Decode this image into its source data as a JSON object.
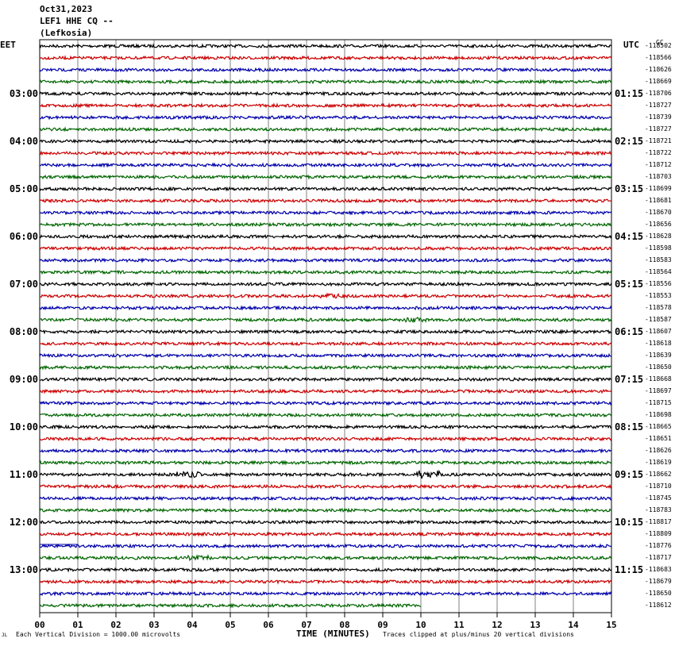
{
  "header": {
    "date": "Oct31,2023",
    "station": "LEF1 HHE CQ --",
    "location": "(Lefkosia)"
  },
  "left_tz": "EET",
  "right_tz": "UTC",
  "corner_mark": "GC",
  "footer": {
    "scale_note": "Each Vertical Division = 1000.00 microvolts",
    "xlabel": "TIME (MINUTES)",
    "clip_note": "Traces clipped at plus/minus 20 vertical divisions",
    "logo_mark": "JL"
  },
  "colors": {
    "trace_cycle": [
      "#000000",
      "#cc0000",
      "#0000aa",
      "#006600"
    ],
    "grid": "#808080"
  },
  "chart_data": {
    "type": "line",
    "title": "",
    "xlabel": "TIME (MINUTES)",
    "ylabel": "",
    "xlim": [
      0,
      15
    ],
    "x_ticks": [
      "00",
      "01",
      "02",
      "03",
      "04",
      "05",
      "06",
      "07",
      "08",
      "09",
      "10",
      "11",
      "12",
      "13",
      "14",
      "15"
    ],
    "left_hour_labels": [
      "03:00",
      "04:00",
      "05:00",
      "06:00",
      "07:00",
      "08:00",
      "09:00",
      "10:00",
      "11:00",
      "12:00",
      "13:00"
    ],
    "right_hour_labels": [
      "01:15",
      "02:15",
      "03:15",
      "04:15",
      "05:15",
      "06:15",
      "07:15",
      "08:15",
      "09:15",
      "10:15",
      "11:15"
    ],
    "trace_offsets": [
      -118502,
      -118566,
      -118626,
      -118669,
      -118706,
      -118727,
      -118739,
      -118727,
      -118721,
      -118722,
      -118712,
      -118703,
      -118699,
      -118681,
      -118670,
      -118656,
      -118628,
      -118598,
      -118583,
      -118564,
      -118556,
      -118553,
      -118578,
      -118587,
      -118607,
      -118618,
      -118639,
      -118650,
      -118668,
      -118697,
      -118715,
      -118698,
      -118665,
      -118651,
      -118626,
      -118619,
      -118662,
      -118710,
      -118745,
      -118783,
      -118817,
      -118809,
      -118776,
      -118717,
      -118683,
      -118679,
      -118650,
      -118612
    ],
    "first_trace_start_minute": 0,
    "last_trace_end_minute": 10,
    "trace_amplitude_divisions": 0.12,
    "noisy_events": [
      {
        "trace": 36,
        "minute": 3.9,
        "amplitude": 0.25
      },
      {
        "trace": 36,
        "minute": 10.2,
        "amplitude": 0.35
      },
      {
        "trace": 21,
        "minute": 7.6,
        "amplitude": 0.2
      },
      {
        "trace": 23,
        "minute": 9.9,
        "amplitude": 0.2
      },
      {
        "trace": 42,
        "minute": 0.5,
        "amplitude": 0.0
      },
      {
        "trace": 43,
        "minute": 4.2,
        "amplitude": 0.2
      }
    ]
  }
}
